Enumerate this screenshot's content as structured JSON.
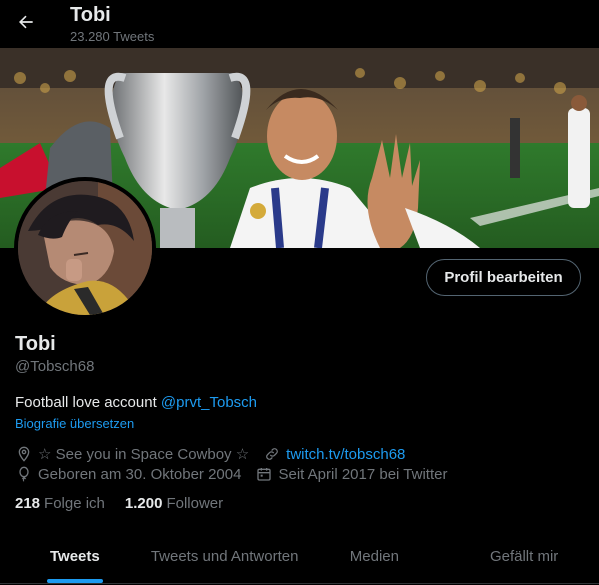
{
  "header": {
    "title": "Tobi",
    "tweet_count": "23.280 Tweets",
    "back_icon": "arrow-left-icon"
  },
  "profile": {
    "edit_button": "Profil bearbeiten",
    "name": "Tobi",
    "handle": "@Tobsch68",
    "bio_text": "Football love account ",
    "bio_mention": "@prvt_Tobsch",
    "translate_bio": "Biografie übersetzen",
    "location": "☆ See you in Space Cowboy ☆",
    "website": "twitch.tv/tobsch68",
    "birthday": "Geboren am 30. Oktober 2004",
    "joined": "Seit April 2017 bei Twitter",
    "following_count": "218",
    "following_label": "Folge ich",
    "followers_count": "1.200",
    "followers_label": "Follower"
  },
  "tabs": [
    {
      "label": "Tweets",
      "active": true
    },
    {
      "label": "Tweets und Antworten",
      "active": false
    },
    {
      "label": "Medien",
      "active": false
    },
    {
      "label": "Gefällt mir",
      "active": false
    }
  ],
  "colors": {
    "background": "#000000",
    "accent": "#1d9bf0",
    "text": "#e7e9ea",
    "secondary_text": "#71767b",
    "border": "#2f3336"
  },
  "icons": [
    "arrow-left-icon",
    "location-pin-icon",
    "link-icon",
    "birthday-balloon-icon",
    "calendar-icon"
  ]
}
